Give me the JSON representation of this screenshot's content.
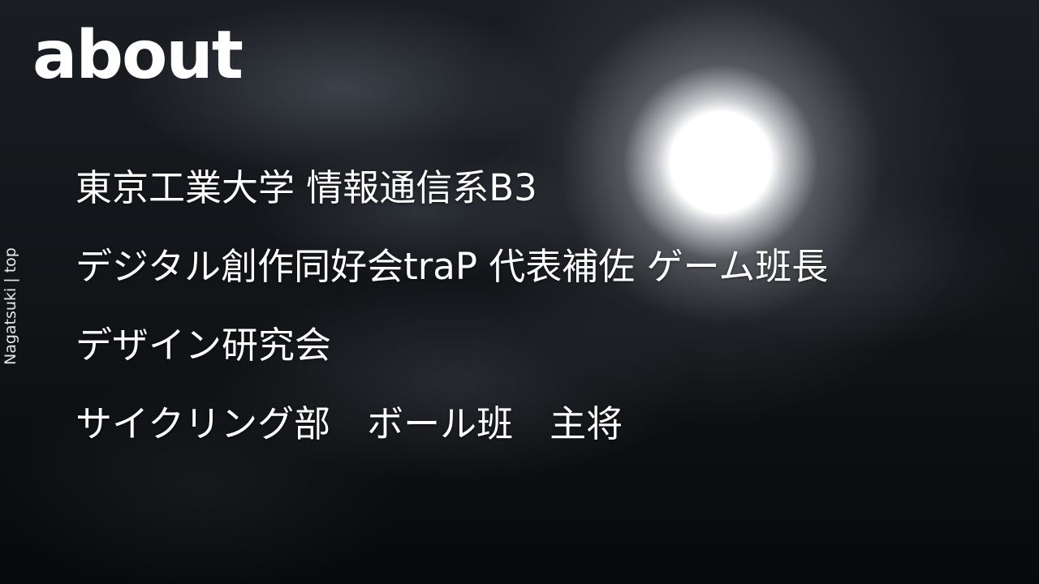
{
  "title": "about",
  "side_label": "Nagatsuki | top",
  "lines": [
    "東京工業大学 情報通信系B3",
    "デジタル創作同好会traP 代表補佐 ゲーム班長",
    "デザイン研究会",
    "サイクリング部　ボール班　主将"
  ]
}
